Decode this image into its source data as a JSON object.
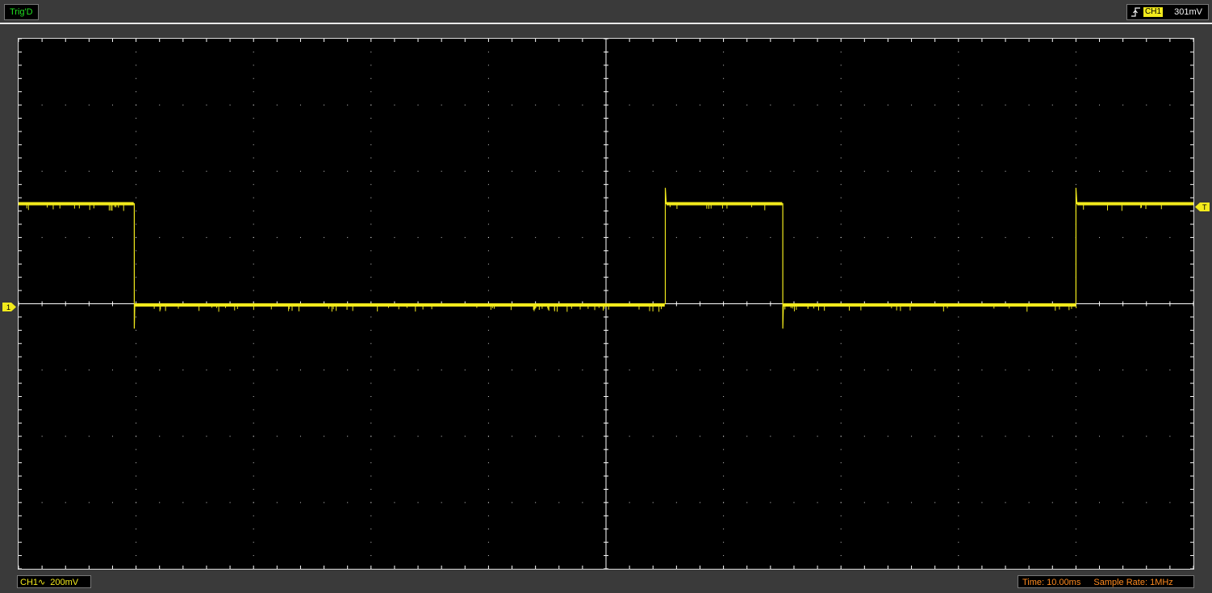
{
  "status": {
    "trigger_state": "Trig'D"
  },
  "trigger": {
    "channel": "CH1",
    "level": "301mV",
    "edge_icon": "rising-edge-icon",
    "marker_label": "T"
  },
  "channel": {
    "name": "CH1",
    "coupling_icon": "ac-coupling-icon",
    "coupling_glyph": "∿",
    "volts_per_div": "200mV",
    "marker_label": "1"
  },
  "timebase": {
    "label": "Time:",
    "value": "10.00ms"
  },
  "sample_rate": {
    "label": "Sample Rate:",
    "value": "1MHz"
  },
  "colors": {
    "trace": "#f2ea1c",
    "screen": "#000000",
    "grid": "#ffffff",
    "status_ok": "#21e021",
    "time_text": "#ff8a1f"
  },
  "chart_data": {
    "type": "line",
    "title": "",
    "xlabel": "",
    "ylabel": "",
    "xlim": [
      -50,
      50
    ],
    "ylim": [
      -800,
      800
    ],
    "x_unit": "ms",
    "y_unit": "mV",
    "grid": true,
    "series": [
      {
        "x": [
          -50,
          -40.2,
          -40.15,
          -40.1,
          5.0,
          5.05,
          5.1,
          15.0,
          15.05,
          15.1,
          5.1,
          50
        ],
        "y": [
          302,
          302,
          -75,
          0,
          0,
          350,
          302,
          302,
          -75,
          0,
          0,
          302
        ],
        "note_skip": true
      }
    ]
  }
}
